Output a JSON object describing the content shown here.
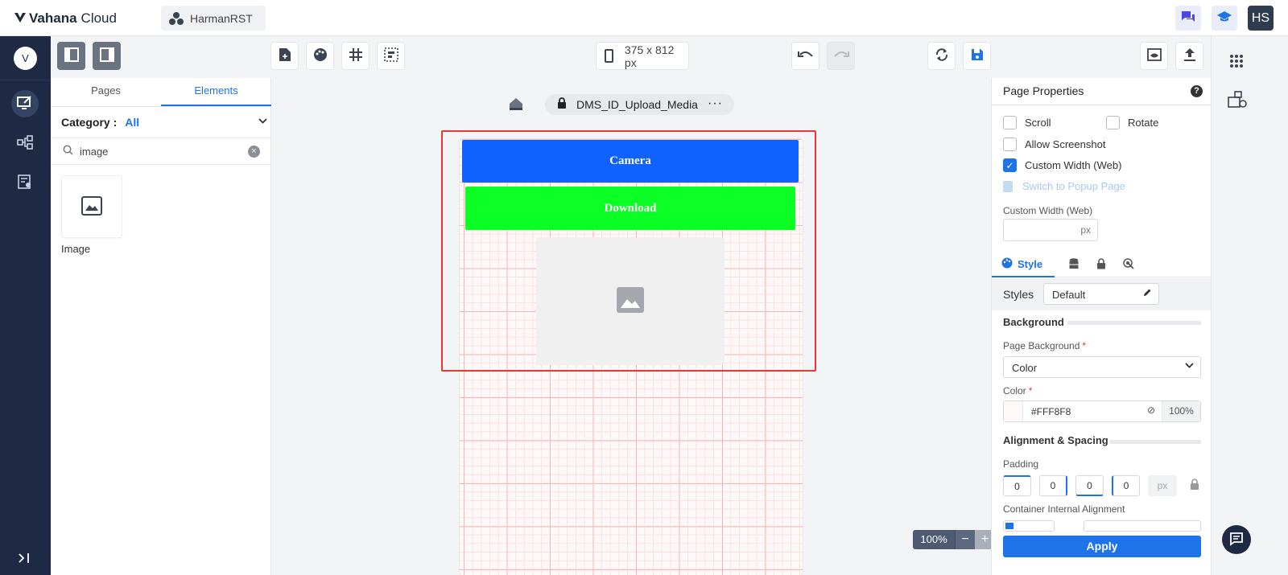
{
  "app": {
    "brand_bold": "Vahana",
    "brand_rest": "Cloud",
    "project": "HarmanRST",
    "user_initials": "HS",
    "nav_initial": "V"
  },
  "toolbar": {
    "device_size": "375 x 812 px"
  },
  "left_panel": {
    "tabs": [
      "Pages",
      "Elements"
    ],
    "category_label": "Category :",
    "category_value": "All",
    "search_value": "image",
    "elements": [
      {
        "label": "Image",
        "icon": "image-icon"
      }
    ]
  },
  "canvas": {
    "page_name": "DMS_ID_Upload_Media",
    "camera_label": "Camera",
    "download_label": "Download",
    "zoom": "100%",
    "zoom_minus": "−",
    "zoom_plus": "+"
  },
  "properties": {
    "title": "Page Properties",
    "help": "?",
    "checkboxes": [
      {
        "label": "Scroll",
        "checked": false
      },
      {
        "label": "Rotate",
        "checked": false
      },
      {
        "label": "Allow Screenshot",
        "checked": false
      },
      {
        "label": "Custom Width (Web)",
        "checked": true
      }
    ],
    "popup_link": "Switch to Popup Page",
    "custom_width_label": "Custom Width (Web)",
    "custom_width_unit": "px",
    "style_tab": "Style",
    "styles_label": "Styles",
    "styles_value": "Default",
    "background_title": "Background",
    "page_bg_label": "Page Background",
    "page_bg_value": "Color",
    "color_label": "Color",
    "color_hex": "#FFF8F8",
    "color_opacity": "100%",
    "align_title": "Alignment & Spacing",
    "padding_label": "Padding",
    "padding": [
      "0",
      "0",
      "0",
      "0"
    ],
    "padding_unit": "px",
    "container_align_label": "Container Internal Alignment",
    "apply_label": "Apply",
    "required_mark": "*"
  },
  "colors": {
    "accent": "#1e73e8",
    "nav": "#1e2a44",
    "camera": "#0f62fe",
    "download": "#0cff24",
    "selection": "#e53935"
  }
}
